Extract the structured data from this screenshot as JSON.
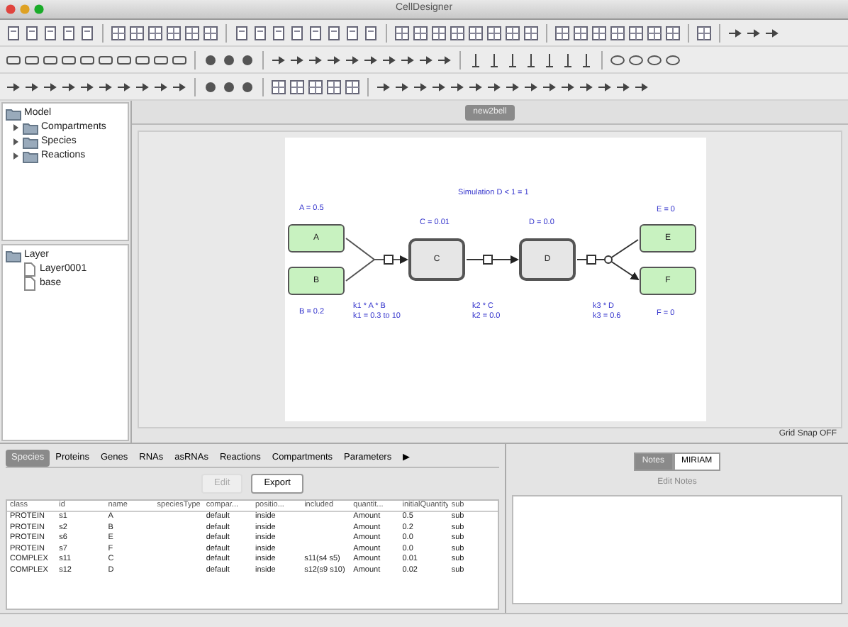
{
  "window": {
    "title": "CellDesigner"
  },
  "model_tree": {
    "label": "Model",
    "children": [
      {
        "label": "Compartments",
        "expanded": false
      },
      {
        "label": "Species",
        "expanded": false
      },
      {
        "label": "Reactions",
        "expanded": false
      }
    ]
  },
  "layer_tree": {
    "label": "Layer",
    "children": [
      {
        "label": "Layer0001"
      },
      {
        "label": "base"
      }
    ]
  },
  "diagram_tabs": [
    {
      "label": "new2bell",
      "selected": true
    }
  ],
  "diagram": {
    "title": "Simulation D < 1 = 1",
    "nodes": [
      {
        "label": "A",
        "kind": "protein"
      },
      {
        "label": "B",
        "kind": "protein"
      },
      {
        "label": "C",
        "kind": "complex"
      },
      {
        "label": "D",
        "kind": "complex"
      },
      {
        "label": "E",
        "kind": "protein"
      },
      {
        "label": "F",
        "kind": "protein"
      }
    ],
    "node_labels": [
      "A = 0.5",
      "B = 0.2",
      "C = 0.01",
      "D = 0.0",
      "E = 0",
      "F = 0"
    ],
    "reaction_labels": [
      [
        "k1 * A * B",
        "k1 = 0.3 to 10"
      ],
      [
        "k2 * C",
        "k2 = 0.0"
      ],
      [
        "k3 * D",
        "k3 = 0.6"
      ]
    ]
  },
  "grid_snap": "Grid Snap OFF",
  "list_tabs": [
    {
      "label": "Species",
      "selected": true
    },
    {
      "label": "Proteins",
      "selected": false
    },
    {
      "label": "Genes",
      "selected": false
    },
    {
      "label": "RNAs",
      "selected": false
    },
    {
      "label": "asRNAs",
      "selected": false
    },
    {
      "label": "Reactions",
      "selected": false
    },
    {
      "label": "Compartments",
      "selected": false
    },
    {
      "label": "Parameters",
      "selected": false
    },
    {
      "label": "▶",
      "selected": false
    }
  ],
  "list_buttons": [
    {
      "label": "Edit",
      "disabled": true
    },
    {
      "label": "Export",
      "disabled": false
    }
  ],
  "table": {
    "columns": [
      "class",
      "id",
      "name",
      "speciesType",
      "compar...",
      "positio...",
      "included",
      "quantit...",
      "initialQuantity",
      "sub"
    ],
    "rows": [
      [
        "PROTEIN",
        "s1",
        "A",
        "",
        "default",
        "inside",
        "",
        "Amount",
        "0.5",
        "sub"
      ],
      [
        "PROTEIN",
        "s2",
        "B",
        "",
        "default",
        "inside",
        "",
        "Amount",
        "0.2",
        "sub"
      ],
      [
        "PROTEIN",
        "s6",
        "E",
        "",
        "default",
        "inside",
        "",
        "Amount",
        "0.0",
        "sub"
      ],
      [
        "PROTEIN",
        "s7",
        "F",
        "",
        "default",
        "inside",
        "",
        "Amount",
        "0.0",
        "sub"
      ],
      [
        "COMPLEX",
        "s11",
        "C",
        "",
        "default",
        "inside",
        "s11(s4 s5)",
        "Amount",
        "0.01",
        "sub"
      ],
      [
        "COMPLEX",
        "s12",
        "D",
        "",
        "default",
        "inside",
        "s12(s9 s10)",
        "Amount",
        "0.02",
        "sub"
      ]
    ]
  },
  "notes_tabs": [
    {
      "label": "Notes",
      "selected": true
    },
    {
      "label": "MIRIAM",
      "selected": false
    }
  ],
  "notes_button": "Edit Notes"
}
